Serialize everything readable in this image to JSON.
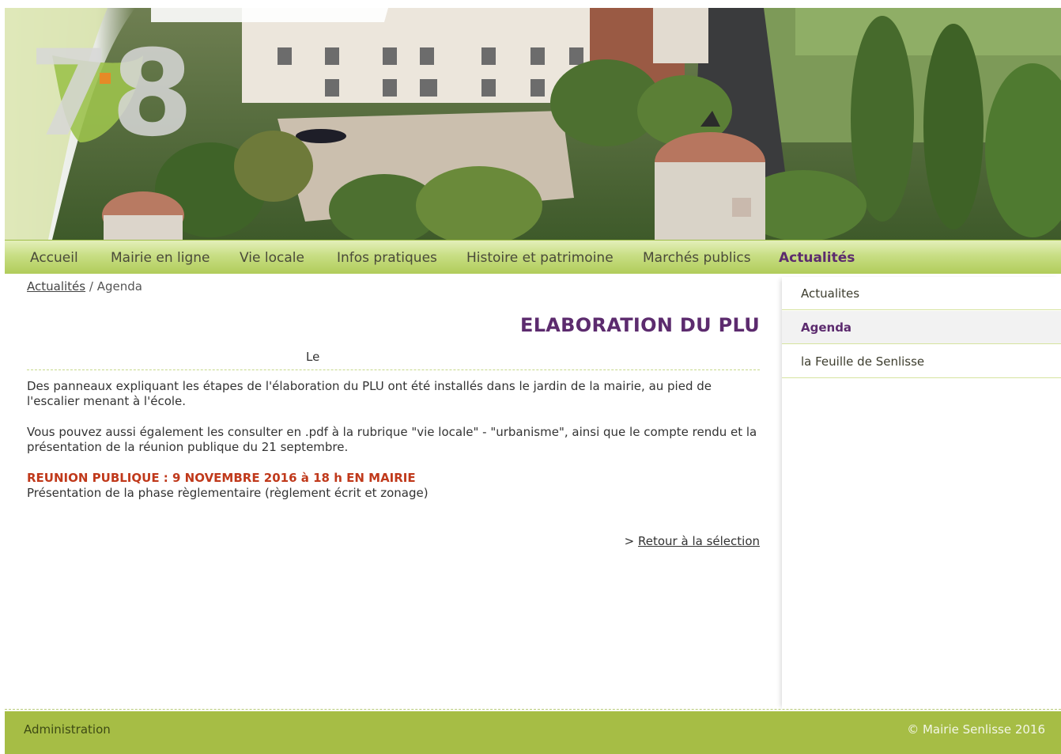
{
  "banner": {
    "logo_digits": "78"
  },
  "nav": {
    "items": [
      {
        "label": "Accueil"
      },
      {
        "label": "Mairie en ligne"
      },
      {
        "label": "Vie locale"
      },
      {
        "label": "Infos pratiques"
      },
      {
        "label": "Histoire et patrimoine"
      },
      {
        "label": "Marchés publics"
      },
      {
        "label": "Actualités",
        "active": true
      }
    ]
  },
  "breadcrumb": {
    "link": "Actualités",
    "separator": " / ",
    "current": "Agenda"
  },
  "article": {
    "title": "ELABORATION DU PLU",
    "date_label": "Le",
    "paragraph1": "Des panneaux expliquant les étapes de l'élaboration du PLU ont été installés dans le jardin de la mairie, au pied de l'escalier menant à l'école.",
    "paragraph2": "Vous pouvez aussi également les consulter en .pdf à la rubrique \"vie locale\" - \"urbanisme\", ainsi que le compte rendu et la présentation de la réunion publique du 21 septembre.",
    "highlight": "REUNION PUBLIQUE : 9 NOVEMBRE 2016 à 18 h EN MAIRIE",
    "paragraph3": "Présentation de la phase règlementaire (règlement écrit et zonage)",
    "return_prefix": "> ",
    "return_link": "Retour à la sélection"
  },
  "sidebar": {
    "items": [
      {
        "label": "Actualites"
      },
      {
        "label": "Agenda",
        "active": true
      },
      {
        "label": "la Feuille de Senlisse"
      }
    ]
  },
  "footer": {
    "admin": "Administration",
    "copyright": "© Mairie Senlisse 2016"
  },
  "colors": {
    "accent": "#5c2b6e",
    "nav_green": "#b1cc5a",
    "footer_green": "#a6bd45",
    "alert_red": "#c0391b"
  }
}
